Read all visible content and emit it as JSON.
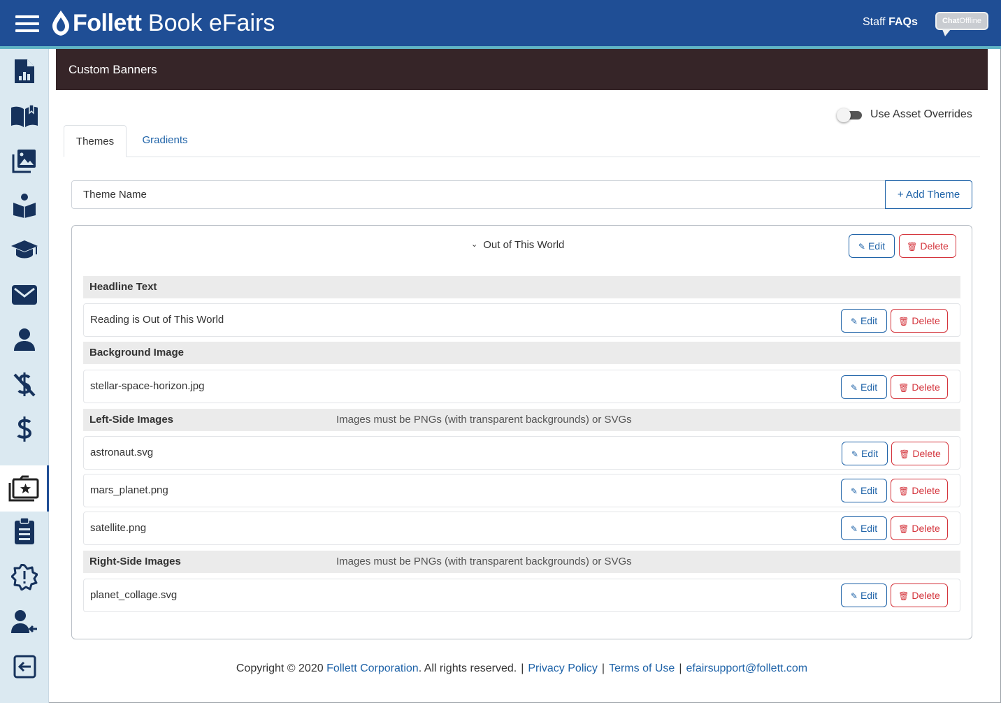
{
  "header": {
    "brand_bold": "Follett",
    "brand_rest": " Book eFairs",
    "staff_prefix": "Staff ",
    "staff_strong": "FAQs",
    "chat_label_bold": "Chat",
    "chat_label_rest": "Offline"
  },
  "sidebar": {
    "items": [
      {
        "icon": "report-document-icon"
      },
      {
        "icon": "open-book-icon"
      },
      {
        "icon": "image-gallery-icon"
      },
      {
        "icon": "reader-icon"
      },
      {
        "icon": "graduation-cap-icon"
      },
      {
        "icon": "envelope-icon"
      },
      {
        "icon": "user-icon"
      },
      {
        "icon": "no-dollar-icon"
      },
      {
        "icon": "dollar-icon"
      },
      {
        "icon": "star-folder-icon",
        "active": true
      },
      {
        "icon": "clipboard-icon"
      },
      {
        "icon": "alert-badge-icon"
      },
      {
        "icon": "user-arrow-icon"
      },
      {
        "icon": "sign-out-icon"
      }
    ]
  },
  "page": {
    "title": "Custom Banners",
    "toggle_label": "Use Asset Overrides",
    "toggle_on": false
  },
  "tabs": [
    {
      "label": "Themes",
      "active": true
    },
    {
      "label": "Gradients",
      "active": false
    }
  ],
  "theme_input": {
    "placeholder": "Theme Name",
    "value": ""
  },
  "add_theme_label": "+ Add Theme",
  "theme": {
    "name": "Out of This World",
    "edit_label": "Edit",
    "delete_label": "Delete",
    "sections": [
      {
        "title": "Headline Text",
        "note": "",
        "items": [
          "Reading is Out of This World"
        ]
      },
      {
        "title": "Background Image",
        "note": "",
        "items": [
          "stellar-space-horizon.jpg"
        ]
      },
      {
        "title": "Left-Side Images",
        "note": "Images must be PNGs (with transparent backgrounds) or SVGs",
        "items": [
          "astronaut.svg",
          "mars_planet.png",
          "satellite.png"
        ]
      },
      {
        "title": "Right-Side Images",
        "note": "Images must be PNGs (with transparent backgrounds) or SVGs",
        "items": [
          "planet_collage.svg"
        ]
      }
    ]
  },
  "footer": {
    "copyright_prefix": "Copyright © 2020 ",
    "corp_link": "Follett Corporation",
    "rights": ". All rights reserved.",
    "sep": "|",
    "privacy": "Privacy Policy",
    "terms": "Terms of Use",
    "email": "efairsupport@follett.com"
  },
  "colors": {
    "header_bg": "#1f4e95",
    "accent_line": "#5fb3c4",
    "content_header_bg": "#362528",
    "sidebar_bg": "#dbe9f1",
    "link": "#1f63a8",
    "danger": "#d4343c"
  }
}
